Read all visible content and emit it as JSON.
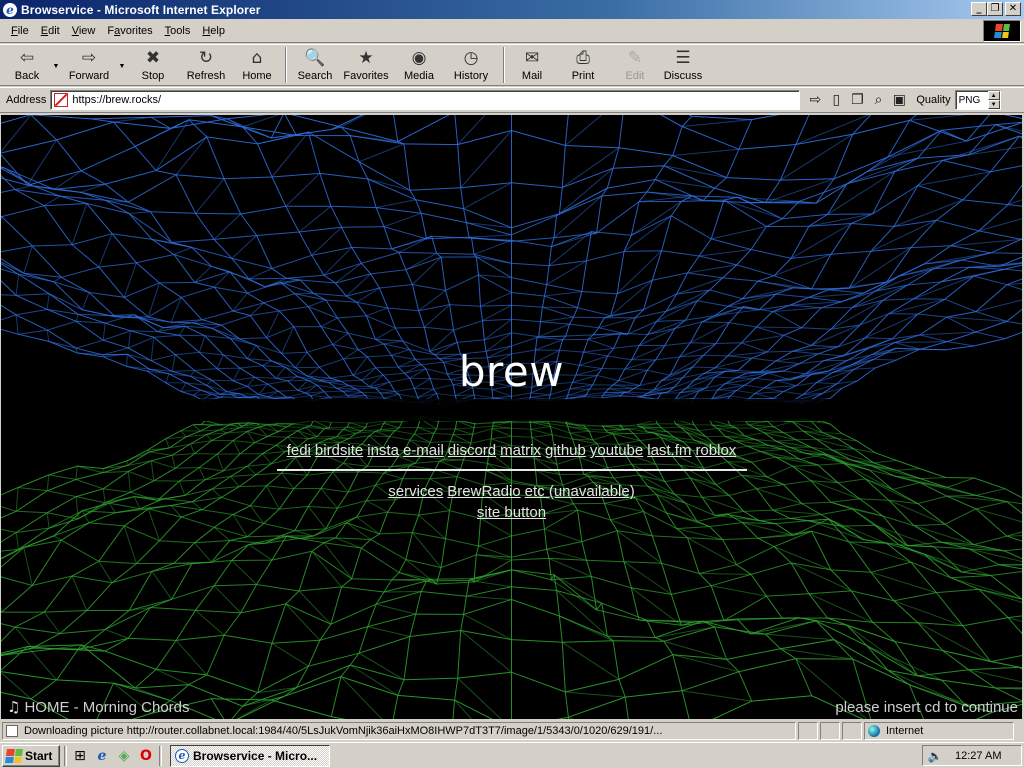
{
  "window": {
    "title": "Browservice - Microsoft Internet Explorer",
    "controls": {
      "minimize": "_",
      "maximize": "❐",
      "close": "✕"
    }
  },
  "menu": {
    "items": [
      {
        "key": "F",
        "rest": "ile"
      },
      {
        "key": "E",
        "rest": "dit"
      },
      {
        "key": "V",
        "rest": "iew"
      },
      {
        "key": "",
        "pre": "F",
        "key2": "a",
        "rest": "vorites"
      },
      {
        "key": "T",
        "rest": "ools"
      },
      {
        "key": "H",
        "rest": "elp"
      }
    ]
  },
  "toolbar": {
    "back": "Back",
    "forward": "Forward",
    "stop": "Stop",
    "refresh": "Refresh",
    "home": "Home",
    "search": "Search",
    "favorites": "Favorites",
    "media": "Media",
    "history": "History",
    "mail": "Mail",
    "print": "Print",
    "edit": "Edit",
    "discuss": "Discuss",
    "icons": {
      "back": "⇦",
      "forward": "⇨",
      "stop": "✖",
      "refresh": "↻",
      "home": "⌂",
      "search": "🔍",
      "favorites": "★",
      "media": "◉",
      "history": "◷",
      "mail": "✉",
      "print": "⎙",
      "edit": "✎",
      "discuss": "☰",
      "dropdown": "▼"
    }
  },
  "address": {
    "label": "Address",
    "url": "https://brew.rocks/",
    "quality_label": "Quality",
    "quality_value": "PNG",
    "icons": {
      "go": "⇨",
      "bookmark": "▯",
      "clipboard": "❐",
      "find": "⌕",
      "save": "▣"
    }
  },
  "page": {
    "title": "brew",
    "social_links": [
      "fedi",
      "birdsite",
      "insta",
      "e-mail",
      "discord",
      "matrix",
      "github",
      "youtube",
      "last.fm",
      "roblox"
    ],
    "service_links": [
      "services",
      "BrewRadio",
      "etc (unavailable)"
    ],
    "site_button_link": "site button",
    "now_playing": "HOME - Morning Chords",
    "note_icon": "♫",
    "insert_cd": "please insert cd to continue",
    "colors": {
      "upper_mesh": "#2f6fe0",
      "lower_mesh": "#2fa12f",
      "background": "#000000"
    }
  },
  "status": {
    "text": "Downloading picture http://router.collabnet.local:1984/40/5LsJukVomNjik36aiHxMO8IHWP7dT3T7/image/1/5343/0/1020/629/191/...",
    "zone": "Internet"
  },
  "taskbar": {
    "start": "Start",
    "task_title": "Browservice - Micro...",
    "clock": "12:27 AM",
    "quick_launch": {
      "desktop": "⊞",
      "ie": "e",
      "channels": "◈",
      "opera": "O"
    }
  }
}
